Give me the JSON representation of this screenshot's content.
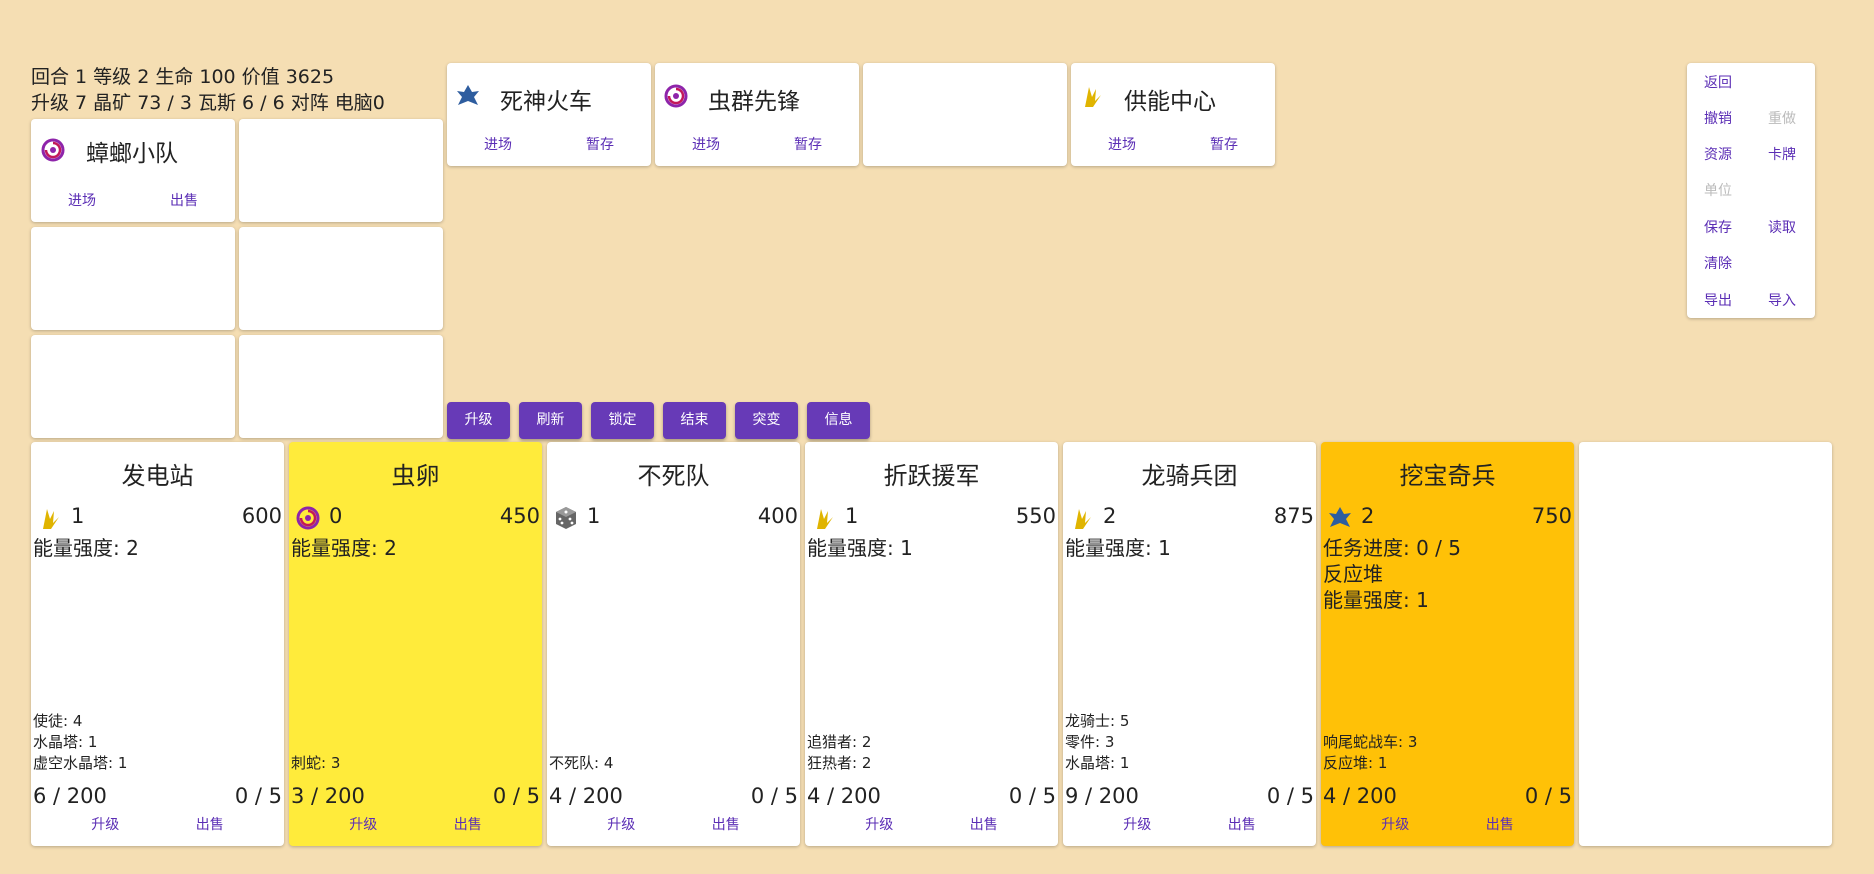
{
  "status": {
    "line1": "回合 1 等级 2 生命 100 价值 3625",
    "line2": "升级 7 晶矿 73 / 3 瓦斯 6 / 6 对阵 电脑0"
  },
  "colors": {
    "accent": "#673ab7",
    "link": "#5b2eb5",
    "background": "#f5deb3",
    "egg": "#ffeb3b",
    "gold": "#ffc107"
  },
  "hand": [
    {
      "name": "蟑螂小队",
      "icon": "zerg-icon",
      "actions": [
        "进场",
        "出售"
      ]
    }
  ],
  "shop": [
    {
      "name": "死神火车",
      "icon": "terran-icon",
      "actions": [
        "进场",
        "暂存"
      ]
    },
    {
      "name": "虫群先锋",
      "icon": "zerg-icon",
      "actions": [
        "进场",
        "暂存"
      ]
    },
    {
      "name": "",
      "icon": "",
      "actions": []
    },
    {
      "name": "供能中心",
      "icon": "protoss-icon",
      "actions": [
        "进场",
        "暂存"
      ]
    }
  ],
  "action_buttons": [
    "升级",
    "刷新",
    "锁定",
    "结束",
    "突变",
    "信息"
  ],
  "menu": {
    "back": "返回",
    "undo": "撤销",
    "redo": "重做",
    "resources": "资源",
    "cards": "卡牌",
    "units": "单位",
    "save": "保存",
    "load": "读取",
    "clear": "清除",
    "export": "导出",
    "import": "导入"
  },
  "board": [
    {
      "name": "发电站",
      "icon": "protoss-icon",
      "level": "1",
      "price": "600",
      "attrs": [
        "能量强度: 2"
      ],
      "units": [
        "使徒: 4",
        "水晶塔: 1",
        "虚空水晶塔: 1"
      ],
      "pop": "6 / 200",
      "quest": "0 / 5",
      "actions": [
        "升级",
        "出售"
      ]
    },
    {
      "name": "虫卵",
      "icon": "zerg-icon",
      "level": "0",
      "price": "450",
      "attrs": [
        "能量强度: 2"
      ],
      "units": [
        "刺蛇: 3"
      ],
      "pop": "3 / 200",
      "quest": "0 / 5",
      "actions": [
        "升级",
        "出售"
      ]
    },
    {
      "name": "不死队",
      "icon": "dice-icon",
      "level": "1",
      "price": "400",
      "attrs": [],
      "units": [
        "不死队: 4"
      ],
      "pop": "4 / 200",
      "quest": "0 / 5",
      "actions": [
        "升级",
        "出售"
      ]
    },
    {
      "name": "折跃援军",
      "icon": "protoss-icon",
      "level": "1",
      "price": "550",
      "attrs": [
        "能量强度: 1"
      ],
      "units": [
        "追猎者: 2",
        "狂热者: 2"
      ],
      "pop": "4 / 200",
      "quest": "0 / 5",
      "actions": [
        "升级",
        "出售"
      ]
    },
    {
      "name": "龙骑兵团",
      "icon": "protoss-icon",
      "level": "2",
      "price": "875",
      "attrs": [
        "能量强度: 1"
      ],
      "units": [
        "龙骑士: 5",
        "零件: 3",
        "水晶塔: 1"
      ],
      "pop": "9 / 200",
      "quest": "0 / 5",
      "actions": [
        "升级",
        "出售"
      ]
    },
    {
      "name": "挖宝奇兵",
      "icon": "terran-icon",
      "level": "2",
      "price": "750",
      "attrs": [
        "任务进度: 0 / 5",
        "反应堆",
        "能量强度: 1"
      ],
      "units": [
        "响尾蛇战车: 3",
        "反应堆: 1"
      ],
      "pop": "4 / 200",
      "quest": "0 / 5",
      "actions": [
        "升级",
        "出售"
      ]
    }
  ]
}
